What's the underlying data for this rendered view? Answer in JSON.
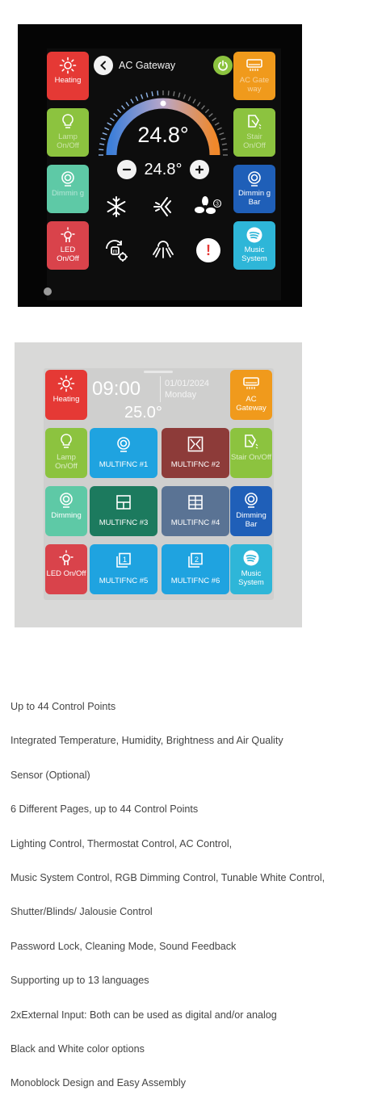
{
  "panel1": {
    "title": "AC Gateway",
    "temperature": "24.8°",
    "setpoint": "24.8°",
    "fan_speed_badge": "3",
    "alert_symbol": "!",
    "left_tiles": [
      {
        "label": "Heating",
        "icon": "sun-icon",
        "color": "#e53935"
      },
      {
        "label": "Lamp On/Off",
        "icon": "bulb-icon",
        "color": "#8cc33f"
      },
      {
        "label": "Dimmin g",
        "icon": "dimmer-icon",
        "color": "#5ec9a6"
      },
      {
        "label": "LED On/Off",
        "icon": "led-icon",
        "color": "#d9434b"
      }
    ],
    "right_tiles": [
      {
        "label": "AC Gate way",
        "icon": "ac-unit-icon",
        "color": "#f09a1c"
      },
      {
        "label": "Stair On/Off",
        "icon": "stair-light-icon",
        "color": "#8cc33f"
      },
      {
        "label": "Dimmin g Bar",
        "icon": "dimmer-icon",
        "color": "#1f5fb8"
      },
      {
        "label": "Music System",
        "icon": "spotify-icon",
        "color": "#2eb6d8"
      }
    ],
    "colors": {
      "gauge_cold": "#3e7fd9",
      "gauge_hot": "#f0882a",
      "power": "#8cc33f"
    }
  },
  "panel2": {
    "time": "09:00",
    "date": "01/01/2024",
    "weekday": "Monday",
    "temperature": "25.0°",
    "left_tiles": [
      {
        "label": "Heating",
        "icon": "sun-icon"
      },
      {
        "label": "Lamp On/Off",
        "icon": "bulb-icon"
      },
      {
        "label": "Dimming",
        "icon": "dimmer-icon"
      },
      {
        "label": "LED On/Off",
        "icon": "led-icon"
      }
    ],
    "right_tiles": [
      {
        "label": "AC Gateway",
        "icon": "ac-unit-icon"
      },
      {
        "label": "Stair On/Off",
        "icon": "stair-light-icon"
      },
      {
        "label": "Dimming Bar",
        "icon": "dimmer-icon"
      },
      {
        "label": "Music System",
        "icon": "spotify-icon"
      }
    ],
    "multifunction": [
      {
        "label": "MULTIFNC #1",
        "icon": "dimmer-icon",
        "color": "#1fa3e0"
      },
      {
        "label": "MULTIFNC #2",
        "icon": "curtain-icon",
        "color": "#8d3b39"
      },
      {
        "label": "MULTIFNC #3",
        "icon": "window-icon",
        "color": "#1c7a5e"
      },
      {
        "label": "MULTIFNC #4",
        "icon": "grid-window-icon",
        "color": "#5a7394"
      },
      {
        "label": "MULTIFNC #5",
        "icon": "page-1-icon",
        "color": "#1fa3e0"
      },
      {
        "label": "MULTIFNC #6",
        "icon": "page-2-icon",
        "color": "#1fa3e0"
      }
    ]
  },
  "features": [
    "Up to 44 Control Points",
    "Integrated Temperature, Humidity, Brightness and Air Quality",
    "Sensor (Optional)",
    "6 Different Pages, up to 44 Control Points",
    "Lighting Control, Thermostat Control, AC Control,",
    "Music System Control, RGB Dimming Control, Tunable White Control,",
    "Shutter/Blinds/ Jalousie Control",
    "Password Lock, Cleaning Mode, Sound Feedback",
    "Supporting up to 13 languages",
    "2xExternal Input: Both can be used as digital and/or analog",
    "Black and White color options",
    "Monoblock Design and Easy Assembly"
  ]
}
